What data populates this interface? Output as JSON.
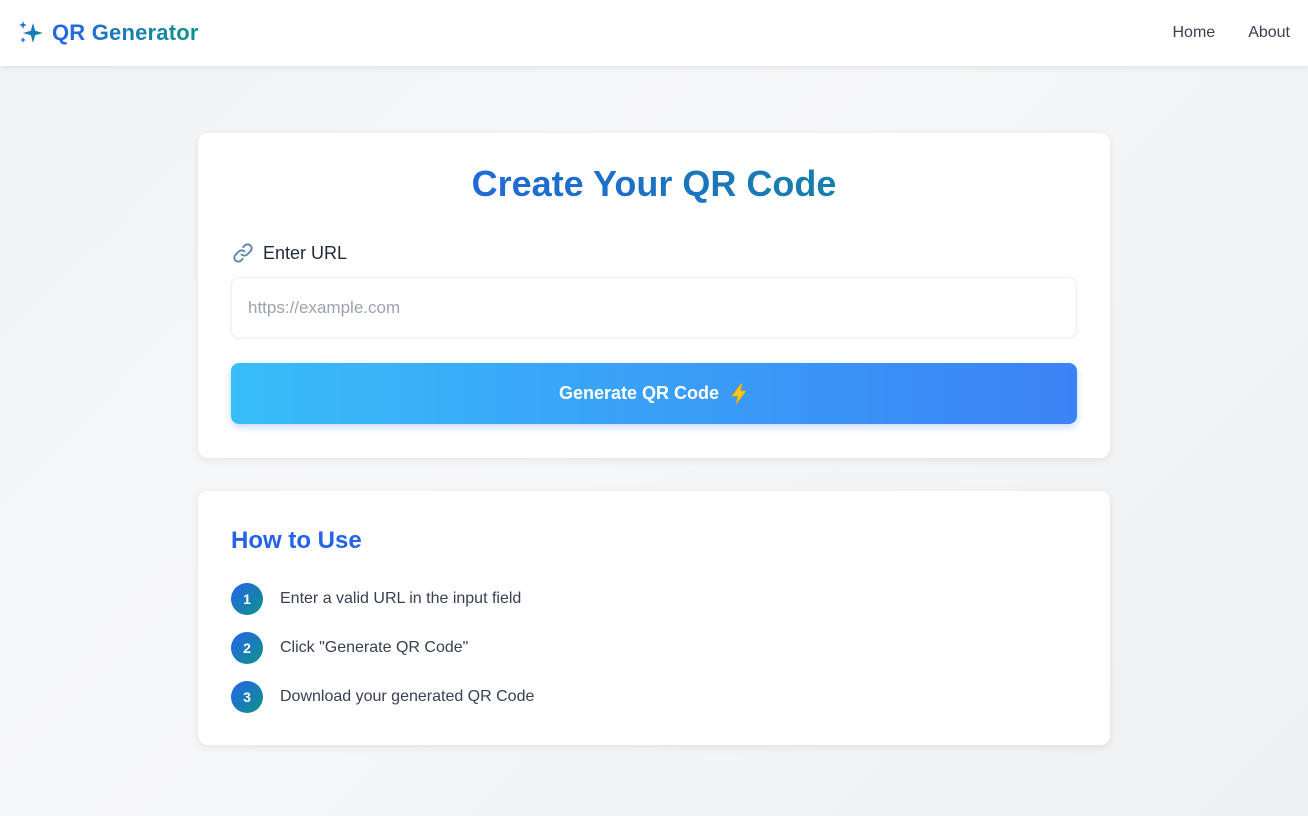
{
  "header": {
    "brand": "QR Generator",
    "brand_icon": "sparkles-icon",
    "nav": [
      "Home",
      "About"
    ]
  },
  "create_card": {
    "title": "Create Your QR Code",
    "url_label": "Enter URL",
    "url_label_icon": "link-icon",
    "url_placeholder": "https://example.com",
    "url_value": "",
    "generate_label": "Generate QR Code",
    "generate_icon": "lightning-bolt-icon"
  },
  "howto": {
    "title": "How to Use",
    "steps": [
      {
        "num": "1",
        "text": "Enter a valid URL in the input field"
      },
      {
        "num": "2",
        "text": "Click \"Generate QR Code\""
      },
      {
        "num": "3",
        "text": "Download your generated QR Code"
      }
    ]
  },
  "colors": {
    "brand_blue": "#2563eb",
    "brand_teal": "#0d9488",
    "button_start": "#38bdf8",
    "button_end": "#3b82f6",
    "bolt": "#facc15"
  }
}
